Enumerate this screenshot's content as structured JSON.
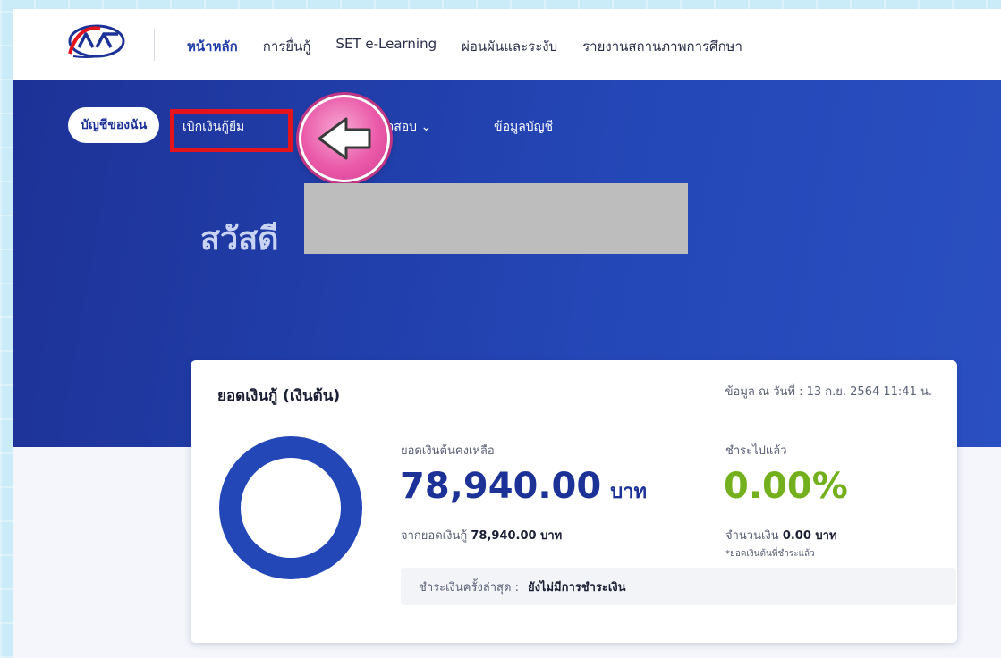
{
  "topnav": {
    "items": [
      "หน้าหลัก",
      "การยื่นกู้",
      "SET e-Learning",
      "ผ่อนผันและระงับ",
      "รายงานสถานภาพการศึกษา"
    ],
    "active_index": 0
  },
  "subnav": {
    "my_account": "บัญชีของฉัน",
    "withdraw": "เบิกเงินกู้ยืม",
    "check": "จสอบ",
    "account_info": "ข้อมูลบัญชี"
  },
  "greeting": "สวัสดี",
  "card": {
    "title": "ยอดเงินกู้ (เงินต้น)",
    "date": "ข้อมูล ณ วันที่ : 13 ก.ย. 2564 11:41 น.",
    "principal_label": "ยอดเงินต้นคงเหลือ",
    "principal_amount": "78,940.00",
    "principal_unit": "บาท",
    "from_total_label": "จากยอดเงินกู้",
    "from_total_value": "78,940.00 บาท",
    "paid_label": "ชำระไปแล้ว",
    "paid_percent": "0.00%",
    "paid_percent_value": 0,
    "amount_label": "จำนวนเงิน",
    "amount_value": "0.00 บาท",
    "amount_note": "*ยอดเงินต้นที่ชำระแล้ว",
    "last_payment_label": "ชำระเงินครั้งล่าสุด :",
    "last_payment_value": "ยังไม่มีการชำระเงิน"
  },
  "colors": {
    "brand_blue": "#1d3297",
    "hero_blue": "#2447b7",
    "paid_green": "#74b01d",
    "highlight_red": "#e3141c",
    "badge_pink": "#ea5aa9"
  }
}
